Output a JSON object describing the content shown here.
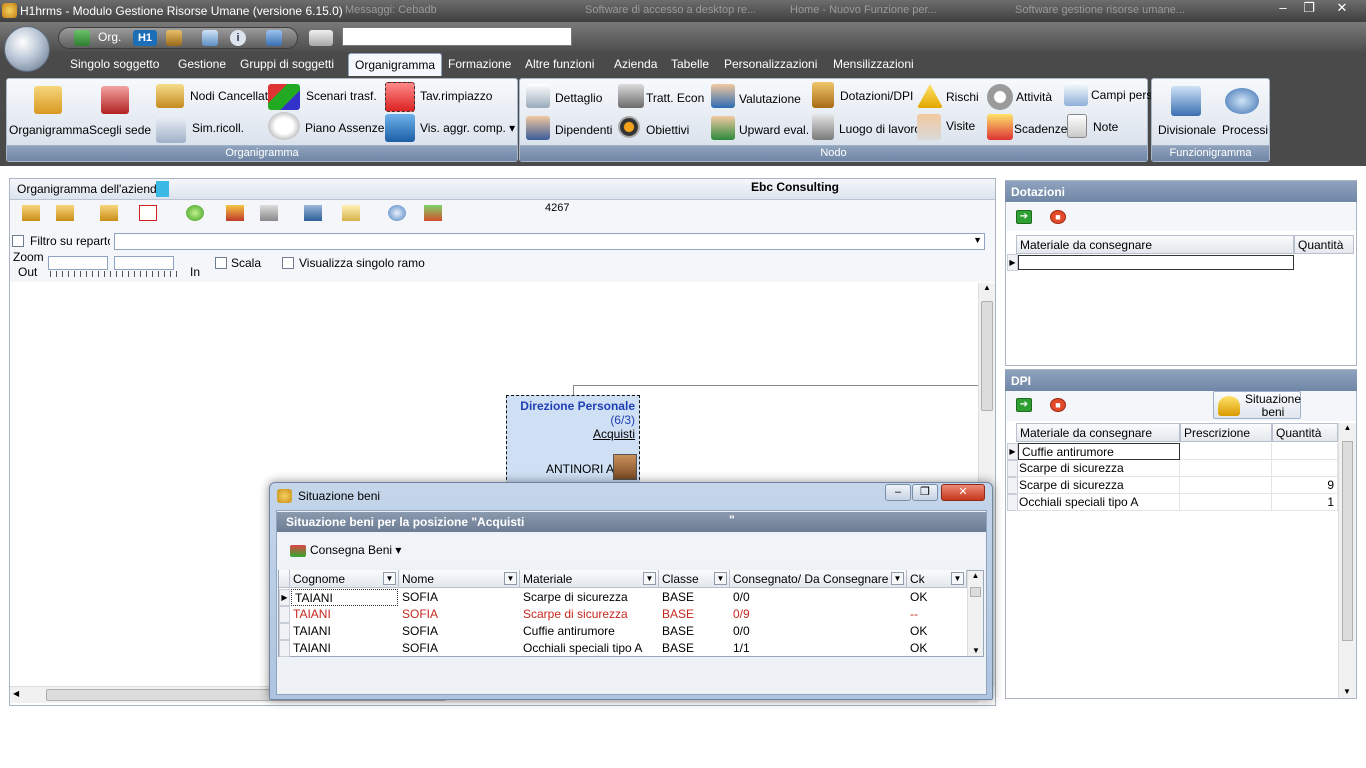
{
  "window": {
    "title": "H1hrms - Modulo Gestione Risorse Umane (versione 6.15.0)",
    "ghost_tabs": [
      "Messaggi: Cebadb",
      "Software di accesso a desktop re...",
      "Home - Nuovo Funzione per...",
      "Software gestione risorse umane..."
    ],
    "buttons": {
      "minimize": "‒",
      "maximize": "❐",
      "close": "✕"
    }
  },
  "qat": {
    "org_label": "Org.",
    "h1_label": "H1",
    "search_value": ""
  },
  "tabs": [
    "Singolo soggetto",
    "Gestione",
    "Gruppi di soggetti",
    "Organigramma",
    "Formazione",
    "Altre funzioni",
    "Azienda",
    "Tabelle",
    "Personalizzazioni",
    "Mensilizzazioni"
  ],
  "ribbon": {
    "organigramma_group": {
      "label": "Organigramma",
      "organigramma": "Organigramma",
      "scegli_sede": "Scegli sede",
      "nodi_cancellati": "Nodi Cancellati",
      "sim_ricoll": "Sim.ricoll.",
      "scenari_trasf": "Scenari trasf.",
      "piano_assenze": "Piano Assenze",
      "tav_rimpiazzo": "Tav.rimpiazzo",
      "vis_aggr_comp": "Vis. aggr. comp."
    },
    "nodo_group": {
      "label": "Nodo",
      "dettaglio": "Dettaglio",
      "dipendenti": "Dipendenti",
      "tratt_econ": "Tratt. Econ",
      "obiettivi": "Obiettivi",
      "valutazione": "Valutazione",
      "upward_eval": "Upward eval.",
      "dotazioni_dpi": "Dotazioni/DPI",
      "luogo_di_lavoro": "Luogo di lavoro",
      "rischi": "Rischi",
      "visite": "Visite",
      "attivita": "Attività",
      "scadenze": "Scadenze",
      "campi_pers": "Campi pers",
      "note": "Note"
    },
    "funzionigramma_group": {
      "label": "Funzionigramma",
      "divisionale": "Divisionale",
      "processi": "Processi"
    }
  },
  "main": {
    "panel_title": "Organigramma dell'aziend",
    "company": "Ebc Consulting",
    "count": "4267",
    "filter_label": "Filtro su reparto",
    "filter_value": "",
    "zoom_label": "Zoom",
    "zoom_out": "Out",
    "zoom_in": "In",
    "scala_label": "Scala",
    "visualizza_label": "Visualizza singolo ramo",
    "node": {
      "name": "Direzione Personale",
      "ratio": "(6/3)",
      "sub": "Acquisti",
      "person": "ANTINORI A."
    }
  },
  "dotazioni": {
    "title": "Dotazioni",
    "columns": [
      "Materiale da consegnare",
      "Quantità"
    ],
    "rows": []
  },
  "dpi": {
    "title": "DPI",
    "situazione_label": "Situazione beni",
    "columns": [
      "Materiale da consegnare",
      "Prescrizione",
      "Quantità"
    ],
    "rows": [
      {
        "materiale": "Cuffie antirumore",
        "prescrizione": "",
        "quantita": ""
      },
      {
        "materiale": "Scarpe di sicurezza",
        "prescrizione": "",
        "quantita": ""
      },
      {
        "materiale": "Scarpe di sicurezza",
        "prescrizione": "",
        "quantita": "9"
      },
      {
        "materiale": "Occhiali speciali tipo A",
        "prescrizione": "",
        "quantita": "1"
      }
    ]
  },
  "dialog": {
    "title": "Situazione beni",
    "header": "Situazione beni per la posizione \"Acquisti",
    "header_quote": "\"",
    "consegna_label": "Consegna Beni",
    "columns": [
      "Cognome",
      "Nome",
      "Materiale",
      "Classe",
      "Consegnato/ Da Consegnare",
      "Ck"
    ],
    "rows": [
      {
        "cognome": "TAIANI",
        "nome": "SOFIA",
        "materiale": "Scarpe di sicurezza",
        "classe": "BASE",
        "consegnato": "0/0",
        "ck": "OK",
        "highlight": false
      },
      {
        "cognome": "TAIANI",
        "nome": "SOFIA",
        "materiale": "Scarpe di sicurezza",
        "classe": "BASE",
        "consegnato": "0/9",
        "ck": "--",
        "highlight": true
      },
      {
        "cognome": "TAIANI",
        "nome": "SOFIA",
        "materiale": "Cuffie antirumore",
        "classe": "BASE",
        "consegnato": "0/0",
        "ck": "OK",
        "highlight": false
      },
      {
        "cognome": "TAIANI",
        "nome": "SOFIA",
        "materiale": "Occhiali speciali tipo A",
        "classe": "BASE",
        "consegnato": "1/1",
        "ck": "OK",
        "highlight": false
      }
    ]
  }
}
